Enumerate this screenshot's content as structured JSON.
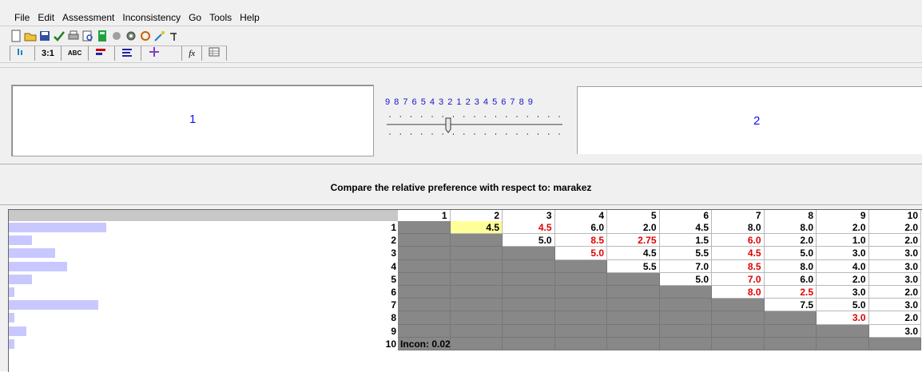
{
  "menu": {
    "items": [
      "File",
      "Edit",
      "Assessment",
      "Inconsistency",
      "Go",
      "Tools",
      "Help"
    ]
  },
  "tabs": [
    "3:1",
    "ABC",
    "fx"
  ],
  "panels": {
    "left_label": "1",
    "right_label": "2"
  },
  "scale": {
    "text": "9 8 7 6 5 4 3 2 1 2 3 4 5 6 7 8 9",
    "slider_position": 0.35
  },
  "compare": {
    "text": "Compare the relative preference with respect to: marakez"
  },
  "matrix": {
    "columns": [
      "1",
      "2",
      "3",
      "4",
      "5",
      "6",
      "7",
      "8",
      "9",
      "10"
    ],
    "rows": [
      "1",
      "2",
      "3",
      "4",
      "5",
      "6",
      "7",
      "8",
      "9",
      "10"
    ],
    "row_bar_levels": [
      0.25,
      0.06,
      0.12,
      0.15,
      0.06,
      0.015,
      0.23,
      0.015,
      0.045,
      0.015
    ],
    "values": [
      [
        null,
        "4.5",
        "4.5",
        "6.0",
        "2.0",
        "4.5",
        "8.0",
        "8.0",
        "2.0",
        "2.0"
      ],
      [
        null,
        null,
        "5.0",
        "8.5",
        "2.75",
        "1.5",
        "6.0",
        "2.0",
        "1.0",
        "2.0"
      ],
      [
        null,
        null,
        null,
        "5.0",
        "4.5",
        "5.5",
        "4.5",
        "5.0",
        "3.0",
        "3.0"
      ],
      [
        null,
        null,
        null,
        null,
        "5.5",
        "7.0",
        "8.5",
        "8.0",
        "4.0",
        "3.0"
      ],
      [
        null,
        null,
        null,
        null,
        null,
        "5.0",
        "7.0",
        "6.0",
        "2.0",
        "3.0"
      ],
      [
        null,
        null,
        null,
        null,
        null,
        null,
        "8.0",
        "2.5",
        "3.0",
        "2.0"
      ],
      [
        null,
        null,
        null,
        null,
        null,
        null,
        null,
        "7.5",
        "5.0",
        "3.0"
      ],
      [
        null,
        null,
        null,
        null,
        null,
        null,
        null,
        null,
        "3.0",
        "2.0"
      ],
      [
        null,
        null,
        null,
        null,
        null,
        null,
        null,
        null,
        null,
        "3.0"
      ],
      [
        null,
        null,
        null,
        null,
        null,
        null,
        null,
        null,
        null,
        null
      ]
    ],
    "red_cells": [
      [
        0,
        2
      ],
      [
        1,
        3
      ],
      [
        1,
        4
      ],
      [
        1,
        6
      ],
      [
        2,
        3
      ],
      [
        2,
        6
      ],
      [
        3,
        6
      ],
      [
        4,
        6
      ],
      [
        5,
        6
      ],
      [
        5,
        7
      ],
      [
        7,
        8
      ]
    ],
    "selected_cell": [
      0,
      1
    ],
    "inconsistency": "Incon: 0.02"
  },
  "colors": {
    "accent_blue": "#1010ff",
    "highlight_yellow": "#ffff99",
    "red_value": "#e00000",
    "grey_cell": "#888888",
    "name_bar": "#c8c8ff"
  }
}
